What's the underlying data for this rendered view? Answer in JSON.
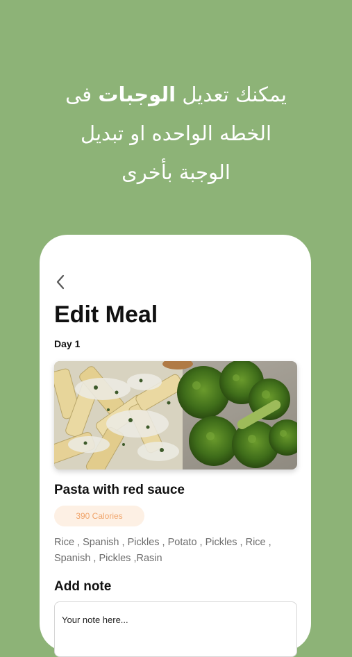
{
  "promo": {
    "line1_before": "يمكنك تعديل ",
    "line1_bold": "الوجبات",
    "line1_after": " فى",
    "line2": "الخطه الواحده او تبديل",
    "line3": "الوجبة بأخرى"
  },
  "screen": {
    "back_icon": "chevron-left-icon",
    "title": "Edit Meal",
    "day": "Day 1",
    "meal_image": "pasta-and-broccoli-photo",
    "meal_name": "Pasta with red sauce",
    "calories": "390 Calories",
    "ingredients": "Rice , Spanish , Pickles , Potato , Pickles , Rice , Spanish , Pickles ,Rasin",
    "note_label": "Add note",
    "note_placeholder": "Your note here..."
  },
  "colors": {
    "background": "#8db377",
    "badge_bg": "#fdf0e4",
    "badge_text": "#f0a46a",
    "ingredients_text": "#6b6b6b"
  }
}
